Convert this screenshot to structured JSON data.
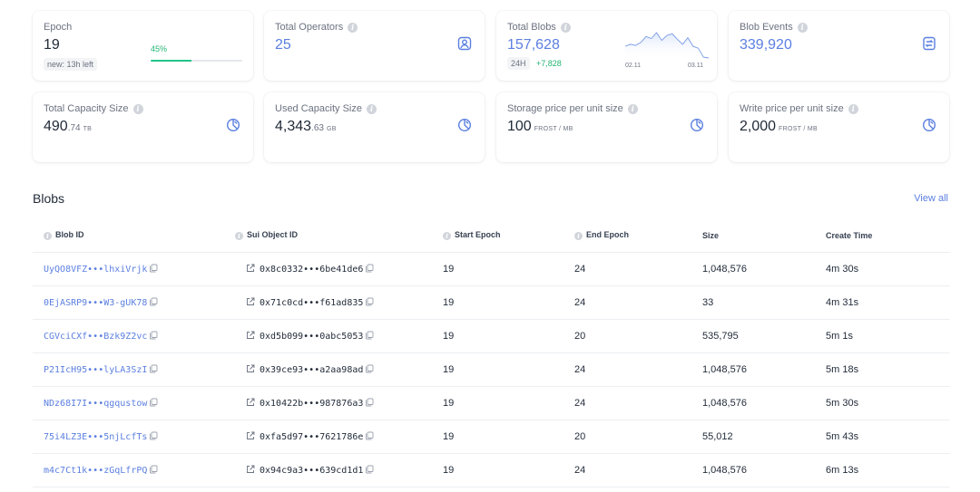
{
  "stats": {
    "epoch": {
      "label": "Epoch",
      "value": "19",
      "progress_pct": "45%",
      "progress": 0.45,
      "badge": "new: 13h left"
    },
    "total_operators": {
      "label": "Total Operators",
      "value": "25"
    },
    "total_blobs": {
      "label": "Total Blobs",
      "value": "157,628",
      "period": "24H",
      "delta": "+7,828",
      "spark_start": "02.11",
      "spark_end": "03.11",
      "spark_values": [
        6,
        6.5,
        6.2,
        7,
        8.5,
        8,
        9.5,
        7.5,
        8.8,
        9.2,
        7.8,
        6.5,
        8.2,
        6,
        5.5,
        3.2,
        3
      ]
    },
    "blob_events": {
      "label": "Blob Events",
      "value": "339,920"
    },
    "total_capacity": {
      "label": "Total Capacity Size",
      "value_int": "490",
      "value_frac": ".74",
      "unit": "TB"
    },
    "used_capacity": {
      "label": "Used Capacity Size",
      "value_int": "4,343",
      "value_frac": ".63",
      "unit": "GB"
    },
    "storage_price": {
      "label": "Storage price per unit size",
      "value": "100",
      "unit": "FROST / MB"
    },
    "write_price": {
      "label": "Write price per unit size",
      "value": "2,000",
      "unit": "FROST / MB"
    }
  },
  "blobs": {
    "title": "Blobs",
    "view_all": "View all",
    "columns": [
      "Blob ID",
      "Sui Object ID",
      "Start Epoch",
      "End Epoch",
      "Size",
      "Create Time"
    ],
    "rows": [
      {
        "blob_id": "UyQO8VFZ•••lhxiVrjk",
        "object_id": "0x8c0332•••6be41de6",
        "start": "19",
        "end": "24",
        "size": "1,048,576",
        "time": "4m 30s"
      },
      {
        "blob_id": "0EjASRP9•••W3-gUK78",
        "object_id": "0x71c0cd•••f61ad835",
        "start": "19",
        "end": "24",
        "size": "33",
        "time": "4m 31s"
      },
      {
        "blob_id": "CGVciCXf•••Bzk9Z2vc",
        "object_id": "0xd5b099•••0abc5053",
        "start": "19",
        "end": "20",
        "size": "535,795",
        "time": "5m 1s"
      },
      {
        "blob_id": "P21IcH95•••lyLA3SzI",
        "object_id": "0x39ce93•••a2aa98ad",
        "start": "19",
        "end": "24",
        "size": "1,048,576",
        "time": "5m 18s"
      },
      {
        "blob_id": "NDz68I7I•••qgqustow",
        "object_id": "0x10422b•••987876a3",
        "start": "19",
        "end": "24",
        "size": "1,048,576",
        "time": "5m 30s"
      },
      {
        "blob_id": "75i4LZ3E•••5njLcfTs",
        "object_id": "0xfa5d97•••7621786e",
        "start": "19",
        "end": "20",
        "size": "55,012",
        "time": "5m 43s"
      },
      {
        "blob_id": "m4c7Ct1k•••zGqLfrPQ",
        "object_id": "0x94c9a3•••639cd1d1",
        "start": "19",
        "end": "24",
        "size": "1,048,576",
        "time": "6m 13s"
      }
    ]
  },
  "colors": {
    "accent": "#5b7fe0",
    "positive": "#22b573"
  }
}
